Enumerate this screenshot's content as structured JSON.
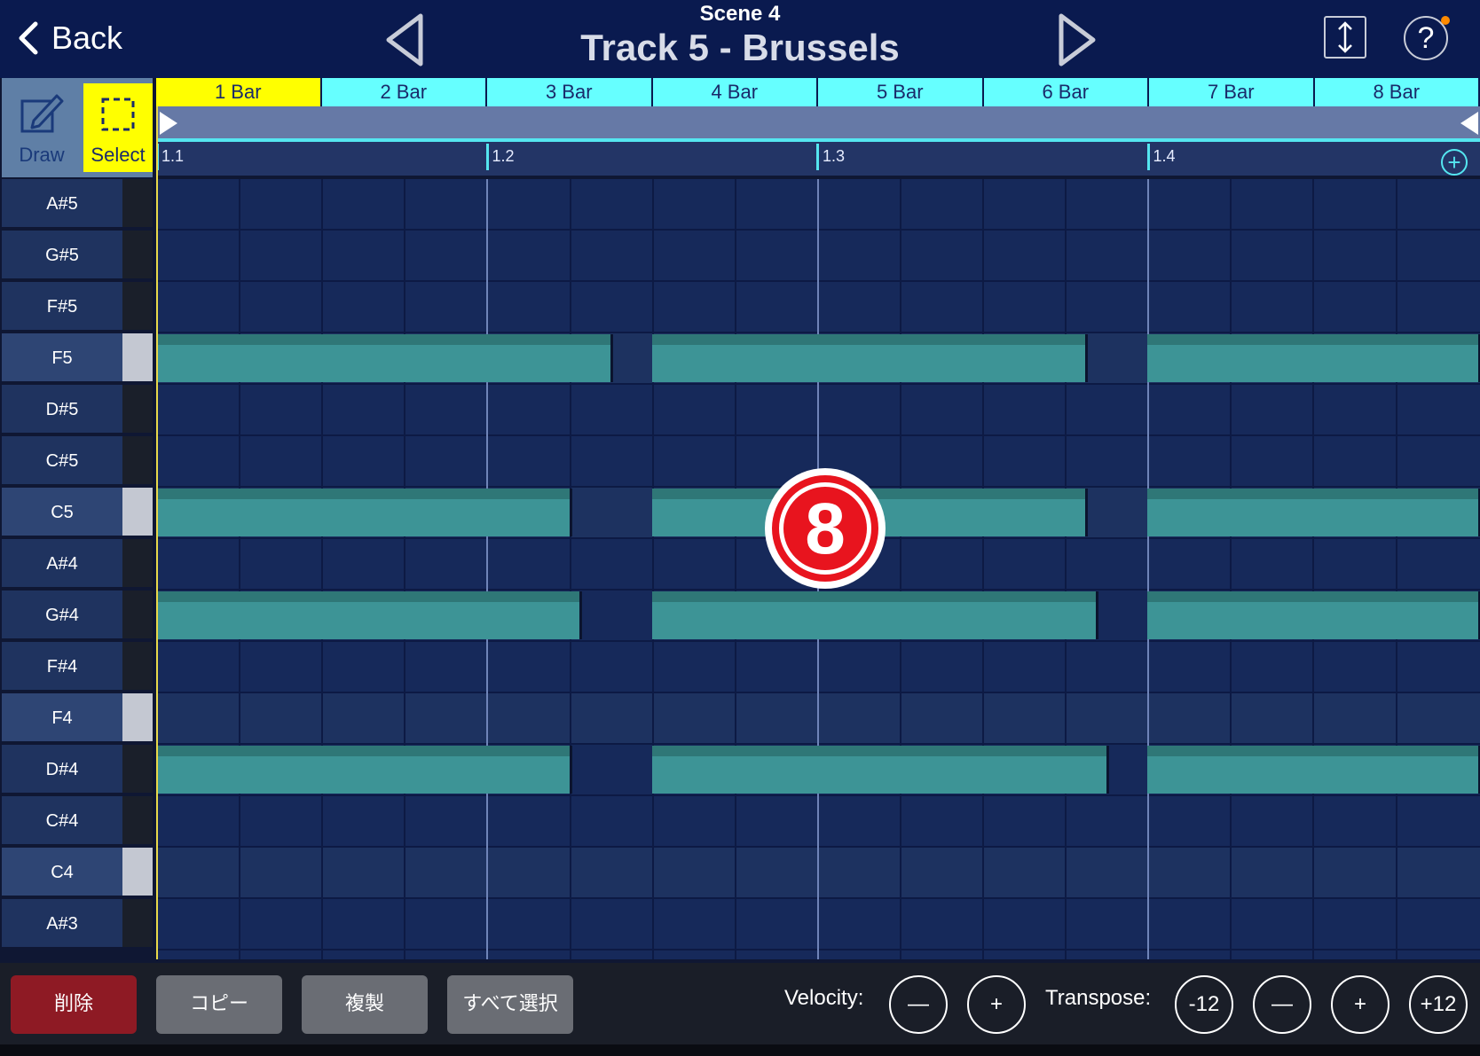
{
  "header": {
    "back_label": "Back",
    "scene": "Scene 4",
    "track_title": "Track 5 - Brussels",
    "help_label": "?"
  },
  "tools": {
    "draw_label": "Draw",
    "select_label": "Select",
    "active": "Select"
  },
  "bars": [
    "1 Bar",
    "2 Bar",
    "3 Bar",
    "4 Bar",
    "5 Bar",
    "6 Bar",
    "7 Bar",
    "8 Bar"
  ],
  "active_bar": "1 Bar",
  "ruler": {
    "marks": [
      "1.1",
      "1.2",
      "1.3",
      "1.4"
    ],
    "add_label": "+"
  },
  "keys": [
    {
      "label": "A#5",
      "white": false
    },
    {
      "label": "G#5",
      "white": false
    },
    {
      "label": "F#5",
      "white": false
    },
    {
      "label": "F5",
      "white": true
    },
    {
      "label": "D#5",
      "white": false
    },
    {
      "label": "C#5",
      "white": false
    },
    {
      "label": "C5",
      "white": true
    },
    {
      "label": "A#4",
      "white": false
    },
    {
      "label": "G#4",
      "white": false
    },
    {
      "label": "F#4",
      "white": false
    },
    {
      "label": "F4",
      "white": true
    },
    {
      "label": "D#4",
      "white": false
    },
    {
      "label": "C#4",
      "white": false
    },
    {
      "label": "C4",
      "white": true
    },
    {
      "label": "A#3",
      "white": false
    }
  ],
  "notes": [
    {
      "key": "F5",
      "start": 0,
      "length": 5.5
    },
    {
      "key": "F5",
      "start": 6,
      "length": 5.25
    },
    {
      "key": "F5",
      "start": 12,
      "length": 4
    },
    {
      "key": "C5",
      "start": 0,
      "length": 5
    },
    {
      "key": "C5",
      "start": 6,
      "length": 5.25
    },
    {
      "key": "C5",
      "start": 12,
      "length": 4
    },
    {
      "key": "G#4",
      "start": 0,
      "length": 5.125
    },
    {
      "key": "G#4",
      "start": 6,
      "length": 5.375
    },
    {
      "key": "G#4",
      "start": 12,
      "length": 4
    },
    {
      "key": "D#4",
      "start": 0,
      "length": 5
    },
    {
      "key": "D#4",
      "start": 6,
      "length": 5.5
    },
    {
      "key": "D#4",
      "start": 12,
      "length": 4
    }
  ],
  "badge": {
    "label": "8",
    "color": "#e8141e"
  },
  "actions": {
    "delete_label": "削除",
    "copy_label": "コピー",
    "duplicate_label": "複製",
    "select_all_label": "すべて選択"
  },
  "velocity": {
    "label": "Velocity:",
    "minus": "—",
    "plus": "+"
  },
  "transpose": {
    "label": "Transpose:",
    "down12": "-12",
    "minus": "—",
    "plus": "+",
    "up12": "+12"
  },
  "colors": {
    "header_bg": "#0a1a4f",
    "bar_cyan": "#66ffff",
    "active_yellow": "#ffff00",
    "note_teal": "#3d9496",
    "delete_red": "#8e1a24"
  }
}
